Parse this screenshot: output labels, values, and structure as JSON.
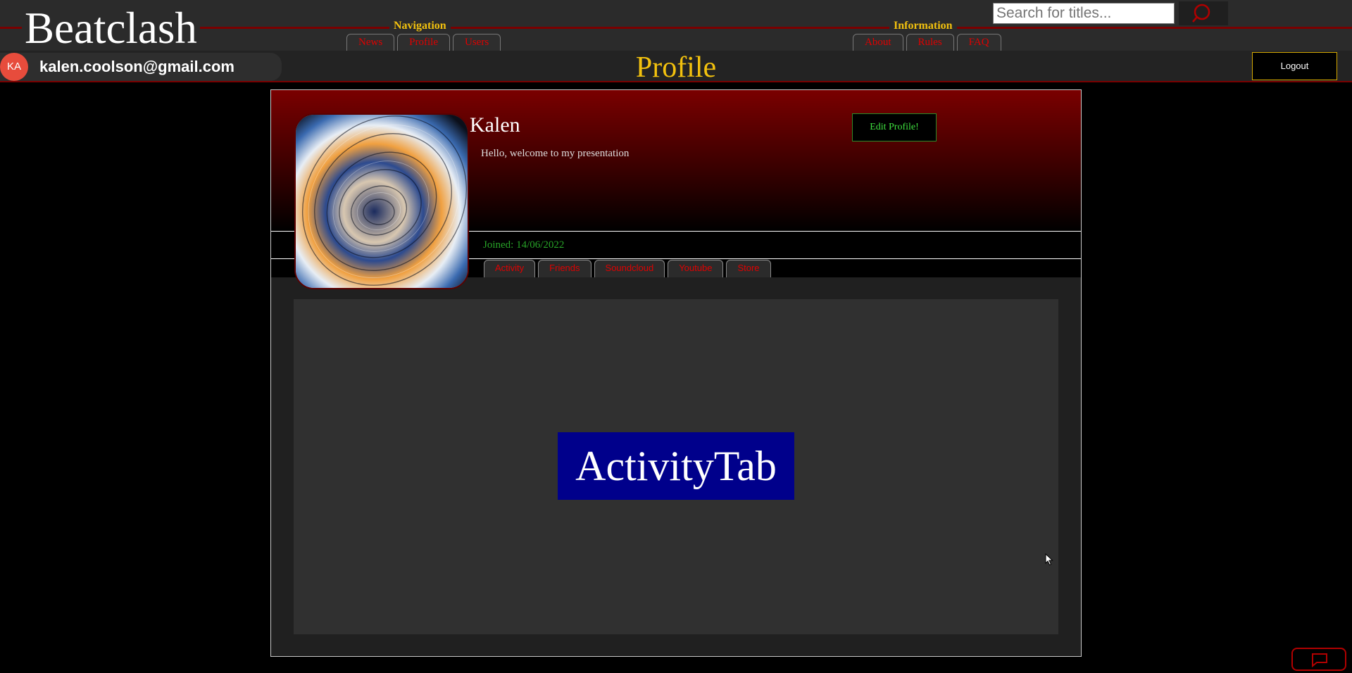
{
  "header": {
    "logo": "Beatclash",
    "navigation": {
      "legend": "Navigation",
      "items": [
        "News",
        "Profile",
        "Users"
      ]
    },
    "information": {
      "legend": "Information",
      "items": [
        "About",
        "Rules",
        "FAQ"
      ]
    },
    "search": {
      "placeholder": "Search for titles..."
    }
  },
  "subbar": {
    "avatar_initials": "KA",
    "email": "kalen.coolson@gmail.com",
    "page_title": "Profile",
    "logout_label": "Logout"
  },
  "profile": {
    "name": "Kalen",
    "bio": "Hello, welcome to my presentation",
    "edit_label": "Edit Profile!",
    "joined": "Joined: 14/06/2022",
    "tabs": [
      "Activity",
      "Friends",
      "Soundcloud",
      "Youtube",
      "Store"
    ],
    "active_content": "ActivityTab"
  },
  "colors": {
    "accent_red": "#e00000",
    "title_gold": "#f2c10e",
    "joined_green": "#27a327",
    "activity_blue": "#00008b"
  }
}
